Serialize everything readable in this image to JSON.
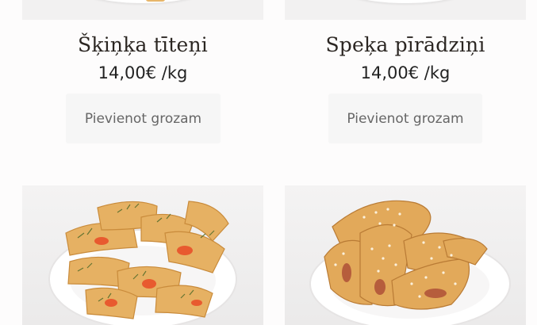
{
  "products": [
    {
      "name": "Šķiņķa tīteņi",
      "price": "14,00€ /kg",
      "button_label": "Pievienot grozam",
      "image_icon": "ham-rolls-plate-image"
    },
    {
      "name": "Speķa pīrādziņi",
      "price": "14,00€ /kg",
      "button_label": "Pievienot grozam",
      "image_icon": "bacon-pastries-plate-image"
    },
    {
      "image_icon": "herb-cheese-rolls-plate-image"
    },
    {
      "image_icon": "sesame-triangle-pastries-plate-image"
    }
  ],
  "colors": {
    "page_bg": "#fdfcfc",
    "button_bg": "#f6f6f6",
    "button_text": "#666666",
    "title_text": "#2b2622",
    "pastry": "#e2a95a"
  }
}
